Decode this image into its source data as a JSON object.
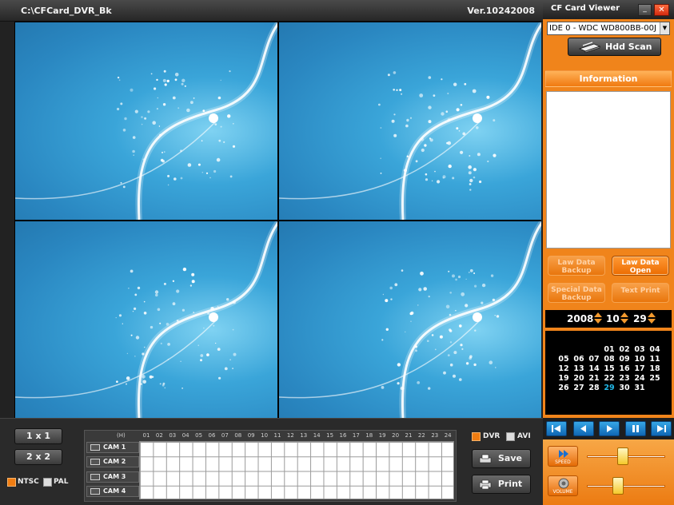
{
  "window": {
    "path": "C:\\CFCard_DVR_Bk",
    "version": "Ver.10242008"
  },
  "layout_buttons": {
    "one": "1 x 1",
    "four": "2 x 2"
  },
  "video_standard": {
    "ntsc": {
      "label": "NTSC",
      "checked": true
    },
    "pal": {
      "label": "PAL",
      "checked": false
    }
  },
  "timeline": {
    "hour_unit": "(H)",
    "hours": [
      "01",
      "02",
      "03",
      "04",
      "05",
      "06",
      "07",
      "08",
      "09",
      "10",
      "11",
      "12",
      "13",
      "14",
      "15",
      "16",
      "17",
      "18",
      "19",
      "20",
      "21",
      "22",
      "23",
      "24"
    ],
    "cameras": [
      "CAM 1",
      "CAM 2",
      "CAM 3",
      "CAM 4"
    ]
  },
  "export_format": {
    "dvr": {
      "label": "DVR",
      "checked": true
    },
    "avi": {
      "label": "AVI",
      "checked": false
    }
  },
  "actions": {
    "save": "Save",
    "print": "Print"
  },
  "panel": {
    "title": "CF Card Viewer",
    "minimize": "_",
    "close": "✕",
    "device": "IDE 0 - WDC WD800BB-00J",
    "hdd_scan": "Hdd Scan",
    "information_title": "Information",
    "law_data_backup": "Law Data Backup",
    "law_data_open": "Law Data Open",
    "special_data_backup": "Special Data Backup",
    "text_print": "Text Print"
  },
  "date": {
    "year": "2008",
    "month": "10",
    "day": "29"
  },
  "calendar": {
    "weeks": [
      [
        "",
        "",
        "",
        "01",
        "02",
        "03",
        "04"
      ],
      [
        "05",
        "06",
        "07",
        "08",
        "09",
        "10",
        "11"
      ],
      [
        "12",
        "13",
        "14",
        "15",
        "16",
        "17",
        "18"
      ],
      [
        "19",
        "20",
        "21",
        "22",
        "23",
        "24",
        "25"
      ],
      [
        "26",
        "27",
        "28",
        "29",
        "30",
        "31",
        ""
      ]
    ],
    "selected": "29"
  },
  "controls": {
    "speed_label": "SPEED",
    "volume_label": "VOLUME",
    "speed_level": 0.45,
    "volume_level": 0.38
  },
  "colors": {
    "accent": "#f0841b",
    "selected_day": "#22b8e8"
  }
}
